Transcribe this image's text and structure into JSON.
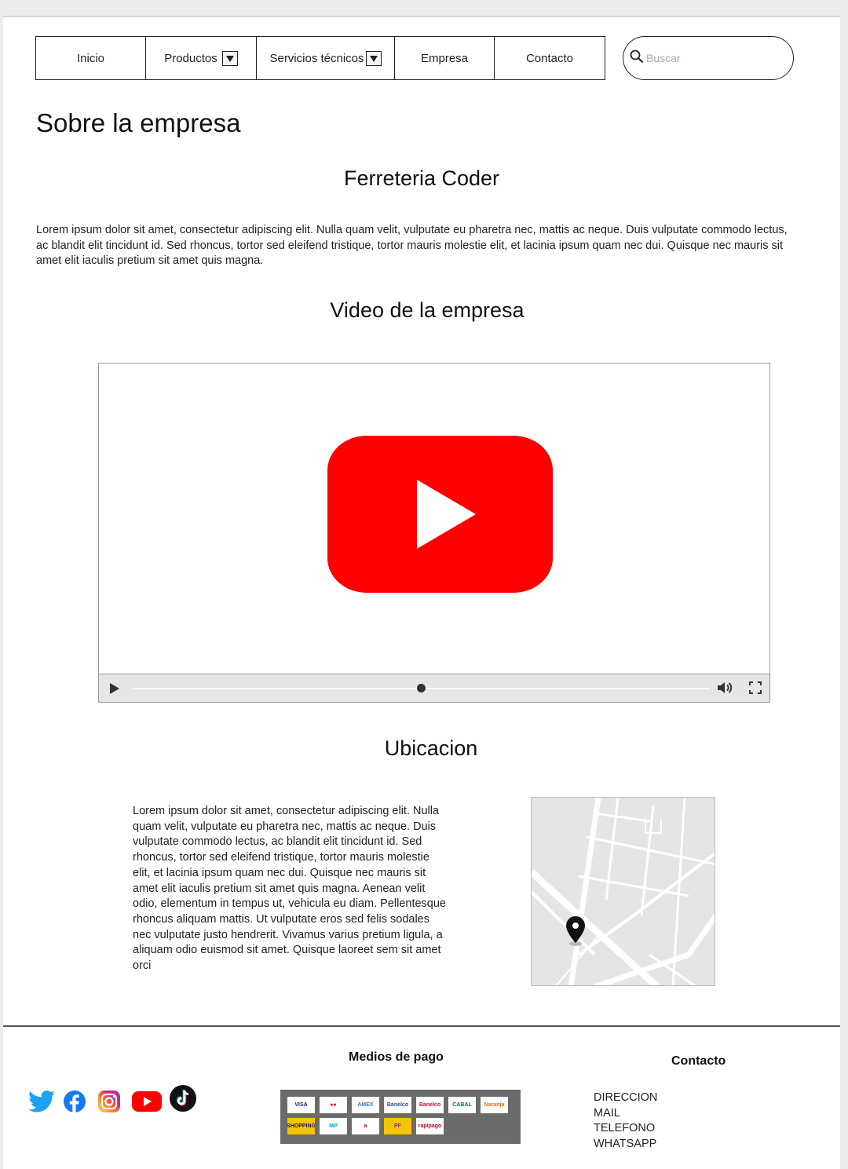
{
  "nav": {
    "items": [
      {
        "label": "Inicio",
        "dropdown": false
      },
      {
        "label": "Productos",
        "dropdown": true
      },
      {
        "label": "Servicios técnicos",
        "dropdown": true
      },
      {
        "label": "Empresa",
        "dropdown": false
      },
      {
        "label": "Contacto",
        "dropdown": false
      }
    ],
    "search_placeholder": "Buscar"
  },
  "page_title": "Sobre la empresa",
  "company": {
    "name": "Ferreteria Coder",
    "description": "Lorem ipsum dolor sit amet, consectetur adipiscing elit. Nulla quam velit, vulputate eu pharetra nec, mattis ac neque. Duis vulputate commodo lectus, ac blandit elit tincidunt id. Sed rhoncus, tortor sed eleifend tristique, tortor mauris molestie elit, et lacinia ipsum quam nec dui. Quisque nec mauris sit amet elit iaculis pretium sit amet quis magna."
  },
  "video": {
    "heading": "Video de la empresa",
    "progress": 0.5
  },
  "location": {
    "heading": "Ubicacion",
    "text": "Lorem ipsum dolor sit amet, consectetur adipiscing elit. Nulla quam velit, vulputate eu pharetra nec, mattis ac neque. Duis vulputate commodo lectus, ac blandit elit tincidunt id. Sed rhoncus, tortor sed eleifend tristique, tortor mauris molestie elit, et lacinia ipsum quam nec dui. Quisque nec mauris sit amet elit iaculis pretium sit amet quis magna. Aenean velit odio, elementum in tempus ut, vehicula eu diam. Pellentesque rhoncus aliquam mattis. Ut vulputate eros sed felis sodales nec vulputate justo hendrerit. Vivamus varius pretium ligula, a aliquam odio euismod sit amet. Quisque laoreet sem sit amet orci"
  },
  "footer": {
    "payment_heading": "Medios de pago",
    "contact_heading": "Contacto",
    "contact_items": [
      "DIRECCION",
      "MAIL",
      "TELEFONO",
      "WHATSAPP"
    ],
    "social_icons": [
      "twitter-icon",
      "facebook-icon",
      "instagram-icon",
      "youtube-icon",
      "tiktok-icon"
    ],
    "payment_cards": [
      {
        "label": "VISA",
        "color": "#1a1f71"
      },
      {
        "label": "●●",
        "color": "#eb001b"
      },
      {
        "label": "AMEX",
        "color": "#2e77bb"
      },
      {
        "label": "Banelco",
        "color": "#1f4e9c"
      },
      {
        "label": "Banelco",
        "color": "#c8102e"
      },
      {
        "label": "CABAL",
        "color": "#00609c"
      },
      {
        "label": "Naranja",
        "color": "#f26722"
      },
      {
        "label": "SHOPPING",
        "color": "#1a1a6e"
      },
      {
        "label": "MP",
        "color": "#009ee3"
      },
      {
        "label": "a",
        "color": "#e30613"
      },
      {
        "label": "PF",
        "color": "#7b2d8b"
      },
      {
        "label": "rapipago",
        "color": "#d0021b"
      }
    ],
    "colors": {
      "twitter": "#1da1f2",
      "facebook": "#1877f2",
      "youtube": "#ff0000"
    }
  }
}
